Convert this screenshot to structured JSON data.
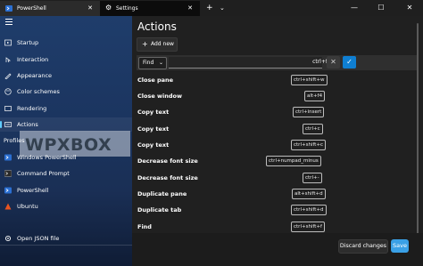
{
  "tabs": [
    {
      "label": "PowerShell",
      "icon": "powershell-icon"
    },
    {
      "label": "Settings",
      "icon": "gear-icon"
    }
  ],
  "tabbar": {
    "new_tab": "+",
    "dropdown": "⌄"
  },
  "window_controls": {
    "minimize": "—",
    "maximize": "☐",
    "close": "✕"
  },
  "sidebar": {
    "items": [
      {
        "label": "Startup",
        "icon": "startup-icon"
      },
      {
        "label": "Interaction",
        "icon": "interaction-icon"
      },
      {
        "label": "Appearance",
        "icon": "appearance-icon"
      },
      {
        "label": "Color schemes",
        "icon": "palette-icon"
      },
      {
        "label": "Rendering",
        "icon": "rendering-icon"
      },
      {
        "label": "Actions",
        "icon": "actions-icon",
        "selected": true
      }
    ],
    "section_label": "Profiles",
    "profiles": [
      {
        "label": "Windows PowerShell",
        "icon": "powershell-icon"
      },
      {
        "label": "Command Prompt",
        "icon": "cmd-icon"
      },
      {
        "label": "PowerShell",
        "icon": "powershell-icon"
      },
      {
        "label": "Ubuntu",
        "icon": "ubuntu-icon"
      }
    ],
    "open_json": "Open JSON file",
    "watermark": "WPXBOX"
  },
  "main": {
    "title": "Actions",
    "add_new": "Add new",
    "edit_row": {
      "action": "Find",
      "keys": "ctrl+f"
    },
    "actions": [
      {
        "name": "Close pane",
        "keys": "ctrl+shift+w"
      },
      {
        "name": "Close window",
        "keys": "alt+f4"
      },
      {
        "name": "Copy text",
        "keys": "ctrl+insert"
      },
      {
        "name": "Copy text",
        "keys": "ctrl+c"
      },
      {
        "name": "Copy text",
        "keys": "ctrl+shift+c"
      },
      {
        "name": "Decrease font size",
        "keys": "ctrl+numpad_minus"
      },
      {
        "name": "Decrease font size",
        "keys": "ctrl+-"
      },
      {
        "name": "Duplicate pane",
        "keys": "alt+shift+d"
      },
      {
        "name": "Duplicate tab",
        "keys": "ctrl+shift+d"
      },
      {
        "name": "Find",
        "keys": "ctrl+shift+f"
      }
    ]
  },
  "footer": {
    "discard": "Discard changes",
    "save": "Save"
  },
  "colors": {
    "accent": "#60cdff",
    "save_button": "#3aa0e6",
    "confirm_button": "#0f7fd2"
  }
}
